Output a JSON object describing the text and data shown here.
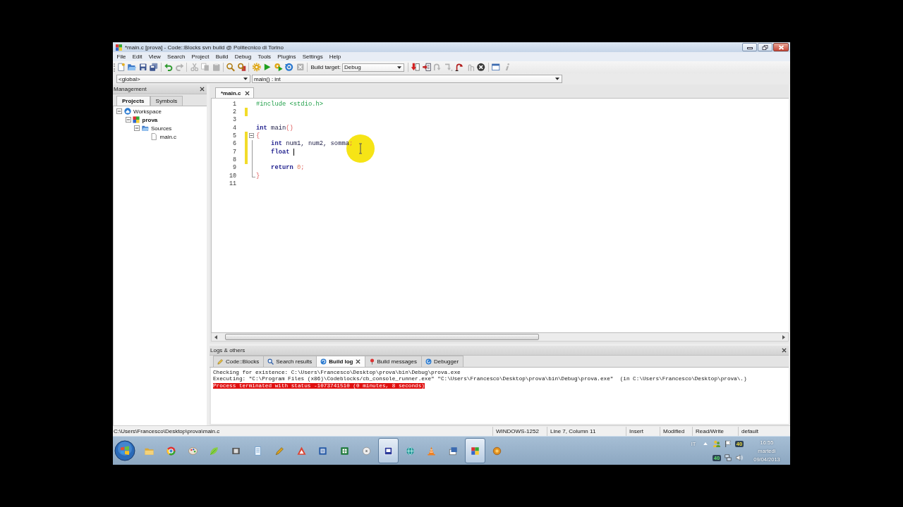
{
  "window": {
    "title": "*main.c [prova] - Code::Blocks svn build @ Politecnico di Torino"
  },
  "menu": [
    "File",
    "Edit",
    "View",
    "Search",
    "Project",
    "Build",
    "Debug",
    "Tools",
    "Plugins",
    "Settings",
    "Help"
  ],
  "toolbar": {
    "items": [
      {
        "kind": "new",
        "disabled": false
      },
      {
        "kind": "open",
        "disabled": false
      },
      {
        "kind": "save",
        "disabled": false
      },
      {
        "kind": "save-all",
        "disabled": false
      },
      {
        "kind": "separator"
      },
      {
        "kind": "undo",
        "disabled": false
      },
      {
        "kind": "redo",
        "disabled": true
      },
      {
        "kind": "separator"
      },
      {
        "kind": "cut",
        "disabled": true
      },
      {
        "kind": "copy",
        "disabled": true
      },
      {
        "kind": "paste",
        "disabled": true
      },
      {
        "kind": "separator"
      },
      {
        "kind": "find",
        "disabled": false
      },
      {
        "kind": "replace",
        "disabled": false
      },
      {
        "kind": "separator"
      },
      {
        "kind": "build",
        "disabled": false
      },
      {
        "kind": "run",
        "disabled": false
      },
      {
        "kind": "build-run",
        "disabled": false
      },
      {
        "kind": "rebuild",
        "disabled": false
      },
      {
        "kind": "abort",
        "disabled": true
      },
      {
        "kind": "separator"
      },
      {
        "kind": "target",
        "label": "Build target:",
        "value": "Debug"
      },
      {
        "kind": "separator"
      },
      {
        "kind": "debug",
        "disabled": false
      },
      {
        "kind": "run-to-cursor",
        "disabled": false
      },
      {
        "kind": "next-line",
        "disabled": true
      },
      {
        "kind": "step-into",
        "disabled": true
      },
      {
        "kind": "step-out",
        "disabled": false
      },
      {
        "kind": "next-instruction",
        "disabled": true
      },
      {
        "kind": "stop",
        "disabled": false
      },
      {
        "kind": "separator"
      },
      {
        "kind": "window",
        "disabled": false
      },
      {
        "kind": "info",
        "disabled": true
      }
    ]
  },
  "code_toolbar": {
    "scope": "<global>",
    "function": "main() : int"
  },
  "management": {
    "title": "Management",
    "tabs": [
      {
        "label": "Projects",
        "selected": true
      },
      {
        "label": "Symbols",
        "selected": false
      }
    ],
    "tree": [
      {
        "label": "Workspace",
        "kind": "workspace",
        "expanded": true,
        "active": false,
        "children": [
          {
            "label": "prova",
            "kind": "project",
            "expanded": true,
            "active": true,
            "children": [
              {
                "label": "Sources",
                "kind": "folder",
                "expanded": true,
                "active": false,
                "children": [
                  {
                    "label": "main.c",
                    "kind": "file",
                    "active": false
                  }
                ]
              }
            ]
          }
        ]
      }
    ]
  },
  "editor": {
    "tabs": [
      {
        "label": "*main.c",
        "selected": true
      }
    ],
    "lines": [
      {
        "number": "1",
        "changed": false,
        "tokens": [
          {
            "text": "#include <stdio.h>",
            "kind": "preprocessor"
          }
        ]
      },
      {
        "number": "2",
        "changed": true
      },
      {
        "number": "3",
        "changed": false
      },
      {
        "number": "4",
        "changed": false,
        "tokens": [
          {
            "text": "int",
            "kind": "keyword"
          },
          {
            "text": " main",
            "kind": "plain"
          },
          {
            "text": "()",
            "kind": "operator"
          }
        ]
      },
      {
        "number": "5",
        "changed": true,
        "fold": true,
        "expanded": true,
        "tokens": [
          {
            "text": "{",
            "kind": "operator"
          }
        ]
      },
      {
        "number": "6",
        "changed": true,
        "tokens": [
          {
            "text": "    int",
            "kind": "keyword"
          },
          {
            "text": " num1, num2, somma",
            "kind": "plain"
          },
          {
            "text": ";",
            "kind": "operator"
          }
        ]
      },
      {
        "number": "7",
        "changed": true,
        "tokens": [
          {
            "text": "    float ",
            "kind": "keyword"
          },
          {
            "kind": "caret"
          }
        ]
      },
      {
        "number": "8",
        "changed": true
      },
      {
        "number": "9",
        "changed": false,
        "tokens": [
          {
            "text": "    return",
            "kind": "keyword"
          },
          {
            "text": " 0",
            "kind": "number"
          },
          {
            "text": ";",
            "kind": "operator"
          }
        ]
      },
      {
        "number": "10",
        "changed": false,
        "fold_end": true,
        "tokens": [
          {
            "text": "}",
            "kind": "operator"
          }
        ]
      },
      {
        "number": "11",
        "changed": false
      }
    ]
  },
  "logs": {
    "title": "Logs & others",
    "tabs": [
      {
        "label": "Code::Blocks",
        "kind": "notes",
        "selected": false
      },
      {
        "label": "Search results",
        "kind": "search",
        "selected": false
      },
      {
        "label": "Build log",
        "kind": "log",
        "selected": true
      },
      {
        "label": "Build messages",
        "kind": "messages",
        "selected": false
      },
      {
        "label": "Debugger",
        "kind": "debugger",
        "selected": false
      }
    ],
    "lines": [
      {
        "text": "Checking for existence: C:\\Users\\Francesco\\Desktop\\prova\\bin\\Debug\\prova.exe",
        "kind": "info"
      },
      {
        "text": "Executing: \"C:\\Program Files (x86)\\Codeblocks/cb_console_runner.exe\" \"C:\\Users\\Francesco\\Desktop\\prova\\bin\\Debug\\prova.exe\"  (in C:\\Users\\Francesco\\Desktop\\prova\\.)",
        "kind": "info"
      },
      {
        "text": "Process terminated with status -1073741510 (0 minutes, 8 seconds)",
        "kind": "error"
      }
    ]
  },
  "status_bar": {
    "path": "C:\\Users\\Francesco\\Desktop\\prova\\main.c",
    "encoding": "WINDOWS-1252",
    "position": "Line 7, Column 11",
    "mode": "Insert",
    "modified": "Modified",
    "access": "Read/Write",
    "profile": "default"
  },
  "taskbar": {
    "apps": [
      {
        "kind": "folder",
        "active": false
      },
      {
        "kind": "wheel",
        "active": false
      },
      {
        "kind": "palette",
        "active": false
      },
      {
        "kind": "leaf",
        "active": false
      },
      {
        "kind": "film",
        "active": false
      },
      {
        "kind": "notepad",
        "active": false
      },
      {
        "kind": "pen",
        "active": false
      },
      {
        "kind": "triangle",
        "active": false
      },
      {
        "kind": "document",
        "active": false
      },
      {
        "kind": "spreadsheet",
        "active": false
      },
      {
        "kind": "disc",
        "active": false
      },
      {
        "kind": "screen",
        "active": true
      },
      {
        "kind": "globe",
        "active": false
      },
      {
        "kind": "cone",
        "active": false
      },
      {
        "kind": "pictures",
        "active": false
      },
      {
        "kind": "squares",
        "active": true
      },
      {
        "kind": "badge",
        "active": false
      }
    ],
    "tray": {
      "language": "IT",
      "top_reading": "40",
      "bottom_reading": "40"
    },
    "clock": {
      "time": "16:55",
      "day": "martedì",
      "date": "09/04/2013"
    }
  }
}
